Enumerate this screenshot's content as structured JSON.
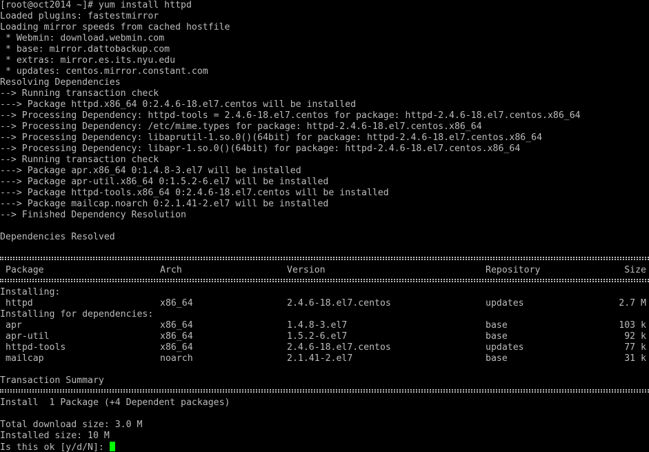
{
  "terminal": {
    "log_lines": [
      "[root@oct2014 ~]# yum install httpd",
      "Loaded plugins: fastestmirror",
      "Loading mirror speeds from cached hostfile",
      " * Webmin: download.webmin.com",
      " * base: mirror.dattobackup.com",
      " * extras: mirror.es.its.nyu.edu",
      " * updates: centos.mirror.constant.com",
      "Resolving Dependencies",
      "--> Running transaction check",
      "---> Package httpd.x86_64 0:2.4.6-18.el7.centos will be installed",
      "--> Processing Dependency: httpd-tools = 2.4.6-18.el7.centos for package: httpd-2.4.6-18.el7.centos.x86_64",
      "--> Processing Dependency: /etc/mime.types for package: httpd-2.4.6-18.el7.centos.x86_64",
      "--> Processing Dependency: libaprutil-1.so.0()(64bit) for package: httpd-2.4.6-18.el7.centos.x86_64",
      "--> Processing Dependency: libapr-1.so.0()(64bit) for package: httpd-2.4.6-18.el7.centos.x86_64",
      "--> Running transaction check",
      "---> Package apr.x86_64 0:1.4.8-3.el7 will be installed",
      "---> Package apr-util.x86_64 0:1.5.2-6.el7 will be installed",
      "---> Package httpd-tools.x86_64 0:2.4.6-18.el7.centos will be installed",
      "---> Package mailcap.noarch 0:2.1.41-2.el7 will be installed",
      "--> Finished Dependency Resolution",
      "",
      "Dependencies Resolved"
    ],
    "table": {
      "headers": {
        "package": "Package",
        "arch": "Arch",
        "version": "Version",
        "repository": "Repository",
        "size": "Size"
      },
      "installing_label": "Installing:",
      "installing": [
        {
          "package": "httpd",
          "arch": "x86_64",
          "version": "2.4.6-18.el7.centos",
          "repository": "updates",
          "size": "2.7 M"
        }
      ],
      "deps_label": "Installing for dependencies:",
      "dependencies": [
        {
          "package": "apr",
          "arch": "x86_64",
          "version": "1.4.8-3.el7",
          "repository": "base",
          "size": "103 k"
        },
        {
          "package": "apr-util",
          "arch": "x86_64",
          "version": "1.5.2-6.el7",
          "repository": "base",
          "size": "92 k"
        },
        {
          "package": "httpd-tools",
          "arch": "x86_64",
          "version": "2.4.6-18.el7.centos",
          "repository": "updates",
          "size": "77 k"
        },
        {
          "package": "mailcap",
          "arch": "noarch",
          "version": "2.1.41-2.el7",
          "repository": "base",
          "size": "31 k"
        }
      ]
    },
    "summary": {
      "title": "Transaction Summary",
      "install_line": "Install  1 Package (+4 Dependent packages)",
      "download_size": "Total download size: 3.0 M",
      "installed_size": "Installed size: 10 M",
      "prompt": "Is this ok [y/d/N]:"
    },
    "cursor_color": "#00ff00",
    "background_color": "#000000",
    "text_color": "#bcbcbc"
  }
}
